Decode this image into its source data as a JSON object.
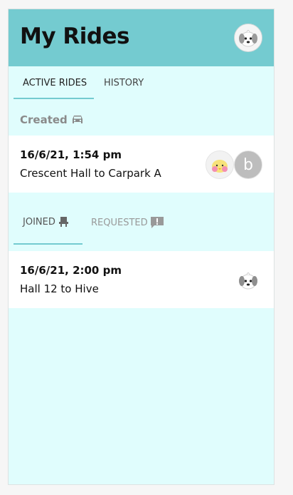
{
  "header": {
    "title": "My Rides"
  },
  "tabs": [
    {
      "label": "ACTIVE RIDES",
      "active": true
    },
    {
      "label": "HISTORY",
      "active": false
    }
  ],
  "created_section": {
    "label": "Created",
    "icon": "car-icon"
  },
  "created_rides": [
    {
      "time": "16/6/21, 1:54 pm",
      "route": "Crescent Hall to Carpark A",
      "participants": [
        "chick-avatar",
        "b"
      ]
    }
  ],
  "subtabs": [
    {
      "label": "JOINED",
      "icon": "seat-icon",
      "active": true
    },
    {
      "label": "REQUESTED",
      "icon": "alert-message-icon",
      "active": false
    }
  ],
  "joined_rides": [
    {
      "time": "16/6/21, 2:00 pm",
      "route": "Hall 12 to Hive",
      "participants": [
        "dog-avatar"
      ]
    }
  ],
  "colors": {
    "accent": "#74cbd0",
    "background": "#e0fdfd"
  }
}
